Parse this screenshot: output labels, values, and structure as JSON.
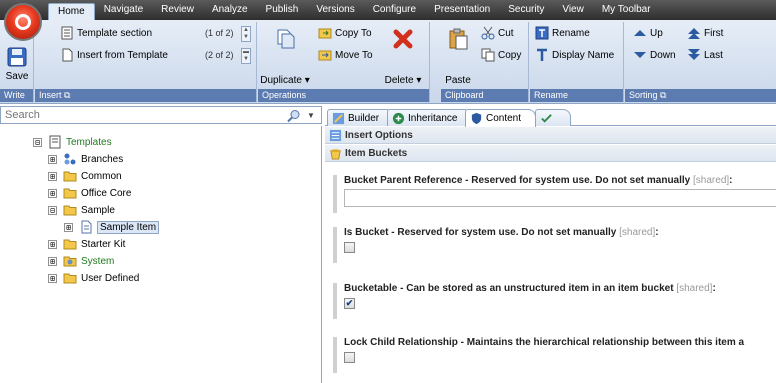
{
  "ribbon_tabs": [
    "Home",
    "Navigate",
    "Review",
    "Analyze",
    "Publish",
    "Versions",
    "Configure",
    "Presentation",
    "Security",
    "View",
    "My Toolbar"
  ],
  "active_ribbon_tab": "Home",
  "groups": {
    "write": {
      "label": "Write",
      "save": "Save"
    },
    "insert": {
      "label": "Insert",
      "template_section": "Template section",
      "template_section_count": "(1 of 2)",
      "insert_from_template": "Insert from Template",
      "insert_from_template_count": "(2 of 2)"
    },
    "operations": {
      "label": "Operations",
      "duplicate": "Duplicate",
      "copy_to": "Copy To",
      "move_to": "Move To",
      "delete": "Delete"
    },
    "clipboard": {
      "label": "Clipboard",
      "paste": "Paste",
      "cut": "Cut",
      "copy": "Copy"
    },
    "rename": {
      "label": "Rename",
      "rename": "Rename",
      "display_name": "Display Name"
    },
    "sorting": {
      "label": "Sorting",
      "up": "Up",
      "down": "Down",
      "first": "First",
      "last": "Last"
    }
  },
  "search": {
    "placeholder": "Search",
    "value": "Search"
  },
  "tree": [
    {
      "label": "Templates",
      "exp": "⊟",
      "icon": "template-icon",
      "green": true
    },
    {
      "label": "Branches",
      "exp": "⊞",
      "icon": "branches-icon"
    },
    {
      "label": "Common",
      "exp": "⊞",
      "icon": "folder-icon"
    },
    {
      "label": "Office Core",
      "exp": "⊞",
      "icon": "folder-icon"
    },
    {
      "label": "Sample",
      "exp": "⊟",
      "icon": "folder-icon"
    },
    {
      "label": "Sample Item",
      "exp": "⊞",
      "icon": "document-icon",
      "selected": true
    },
    {
      "label": "Starter Kit",
      "exp": "⊞",
      "icon": "folder-icon"
    },
    {
      "label": "System",
      "exp": "⊞",
      "icon": "system-folder-icon",
      "green": true
    },
    {
      "label": "User Defined",
      "exp": "⊞",
      "icon": "folder-icon"
    }
  ],
  "editor_tabs": [
    "Builder",
    "Inheritance",
    "Content",
    ""
  ],
  "active_editor_tab": "Content",
  "sections": {
    "insert_options": "Insert Options",
    "item_buckets": "Item Buckets"
  },
  "fields": [
    {
      "label": "Bucket Parent Reference - Reserved for system use. Do not set manually",
      "shared": "[shared]",
      "suffix": ":",
      "type": "text",
      "value": ""
    },
    {
      "label": "Is Bucket - Reserved for system use. Do not set manually",
      "shared": "[shared]",
      "suffix": ":",
      "type": "checkbox",
      "checked": false
    },
    {
      "label": "Bucketable - Can be stored as an unstructured item in an item bucket",
      "shared": "[shared]",
      "suffix": ":",
      "type": "checkbox",
      "checked": true
    },
    {
      "label": "Lock Child Relationship - Maintains the hierarchical relationship between this item a",
      "shared": "",
      "suffix": "",
      "type": "checkbox",
      "checked": false
    }
  ],
  "colors": {
    "ribbon_group_label": "#5c7bb0",
    "green_node": "#1f7a1f",
    "accent_border": "#8ea5c4"
  }
}
